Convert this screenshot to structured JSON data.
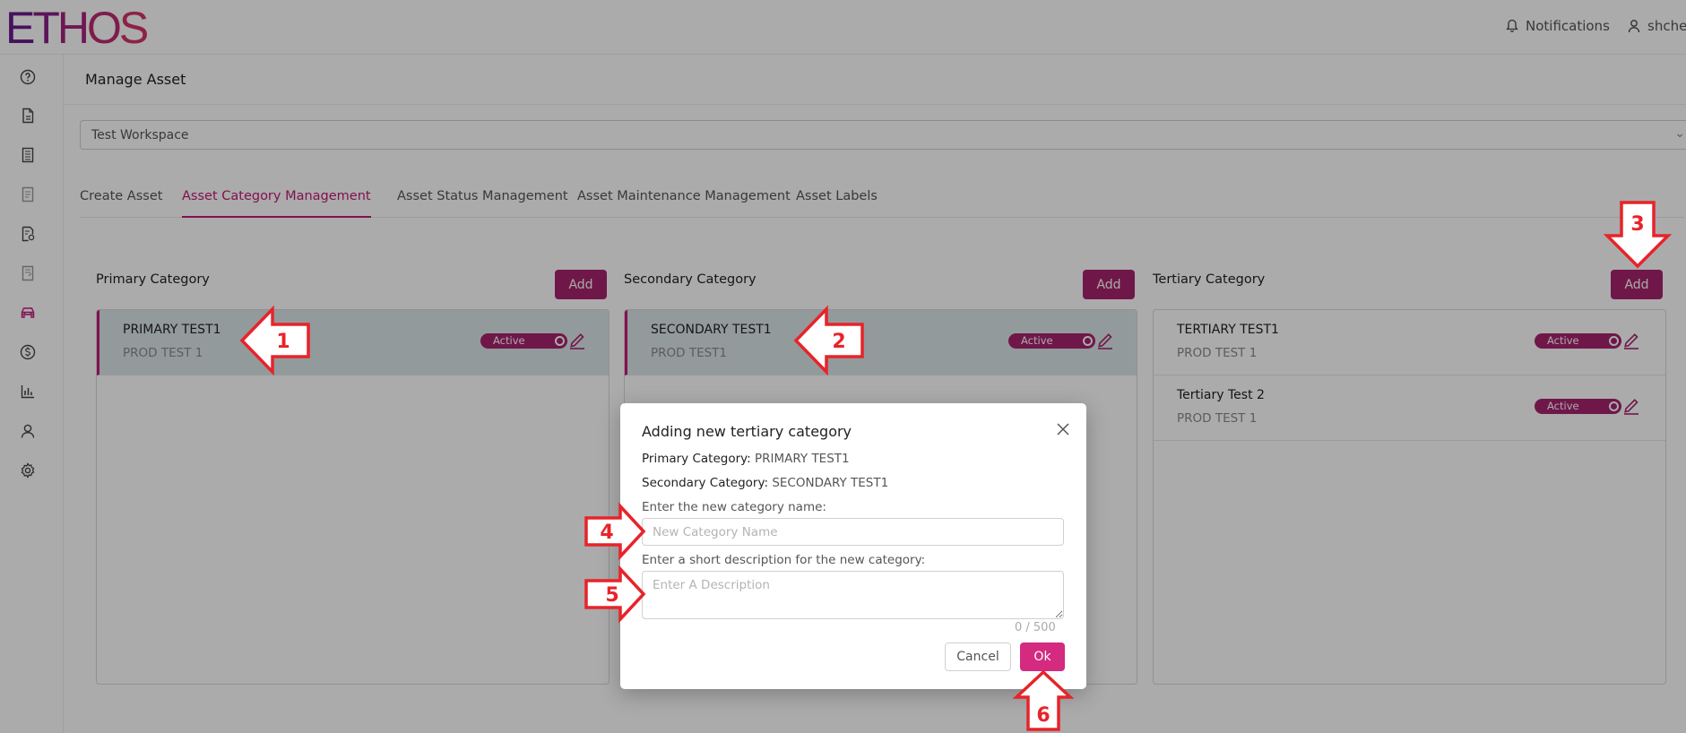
{
  "app": {
    "logo": "ETHOS",
    "notifications_label": "Notifications",
    "user_label": "shchee"
  },
  "sidebar": {
    "items": [
      {
        "icon": "help-icon"
      },
      {
        "icon": "document-icon"
      },
      {
        "icon": "ledger-icon"
      },
      {
        "icon": "invoice-icon"
      },
      {
        "icon": "report-settings-icon"
      },
      {
        "icon": "notes-icon"
      },
      {
        "icon": "car-icon"
      },
      {
        "icon": "dollar-icon"
      },
      {
        "icon": "bar-chart-icon"
      },
      {
        "icon": "user-icon"
      },
      {
        "icon": "gear-icon"
      }
    ]
  },
  "page": {
    "title": "Manage Asset",
    "workspace": "Test Workspace"
  },
  "tabs": [
    {
      "label": "Create Asset"
    },
    {
      "label": "Asset Category Management",
      "active": true
    },
    {
      "label": "Asset Status Management"
    },
    {
      "label": "Asset Maintenance Management"
    },
    {
      "label": "Asset Labels"
    }
  ],
  "columns": {
    "primary": {
      "title": "Primary Category",
      "add_label": "Add",
      "rows": [
        {
          "name": "PRIMARY TEST1",
          "description": "PROD TEST 1",
          "status": "Active",
          "selected": true
        }
      ]
    },
    "secondary": {
      "title": "Secondary Category",
      "add_label": "Add",
      "rows": [
        {
          "name": "SECONDARY TEST1",
          "description": "PROD TEST1",
          "status": "Active",
          "selected": true
        }
      ]
    },
    "tertiary": {
      "title": "Tertiary Category",
      "add_label": "Add",
      "rows": [
        {
          "name": "TERTIARY TEST1",
          "description": "PROD TEST 1",
          "status": "Active"
        },
        {
          "name": "Tertiary Test 2",
          "description": "PROD TEST 1",
          "status": "Active"
        }
      ]
    }
  },
  "modal": {
    "title": "Adding new tertiary category",
    "primary_label": "Primary Category:",
    "primary_value": "PRIMARY TEST1",
    "secondary_label": "Secondary Category:",
    "secondary_value": "SECONDARY TEST1",
    "name_label": "Enter the new category name:",
    "name_placeholder": "New Category Name",
    "name_value": "",
    "desc_label": "Enter a short description for the new category:",
    "desc_placeholder": "Enter A Description",
    "desc_value": "",
    "counter": "0 / 500",
    "cancel_label": "Cancel",
    "ok_label": "Ok"
  },
  "annotations": [
    "1",
    "2",
    "3",
    "4",
    "5",
    "6"
  ],
  "colors": {
    "accent": "#a8236f",
    "ok_button": "#d42a80",
    "active_tab": "#c2187a",
    "selected_row": "#dbe6e7",
    "annotation_red": "#e8232a"
  }
}
